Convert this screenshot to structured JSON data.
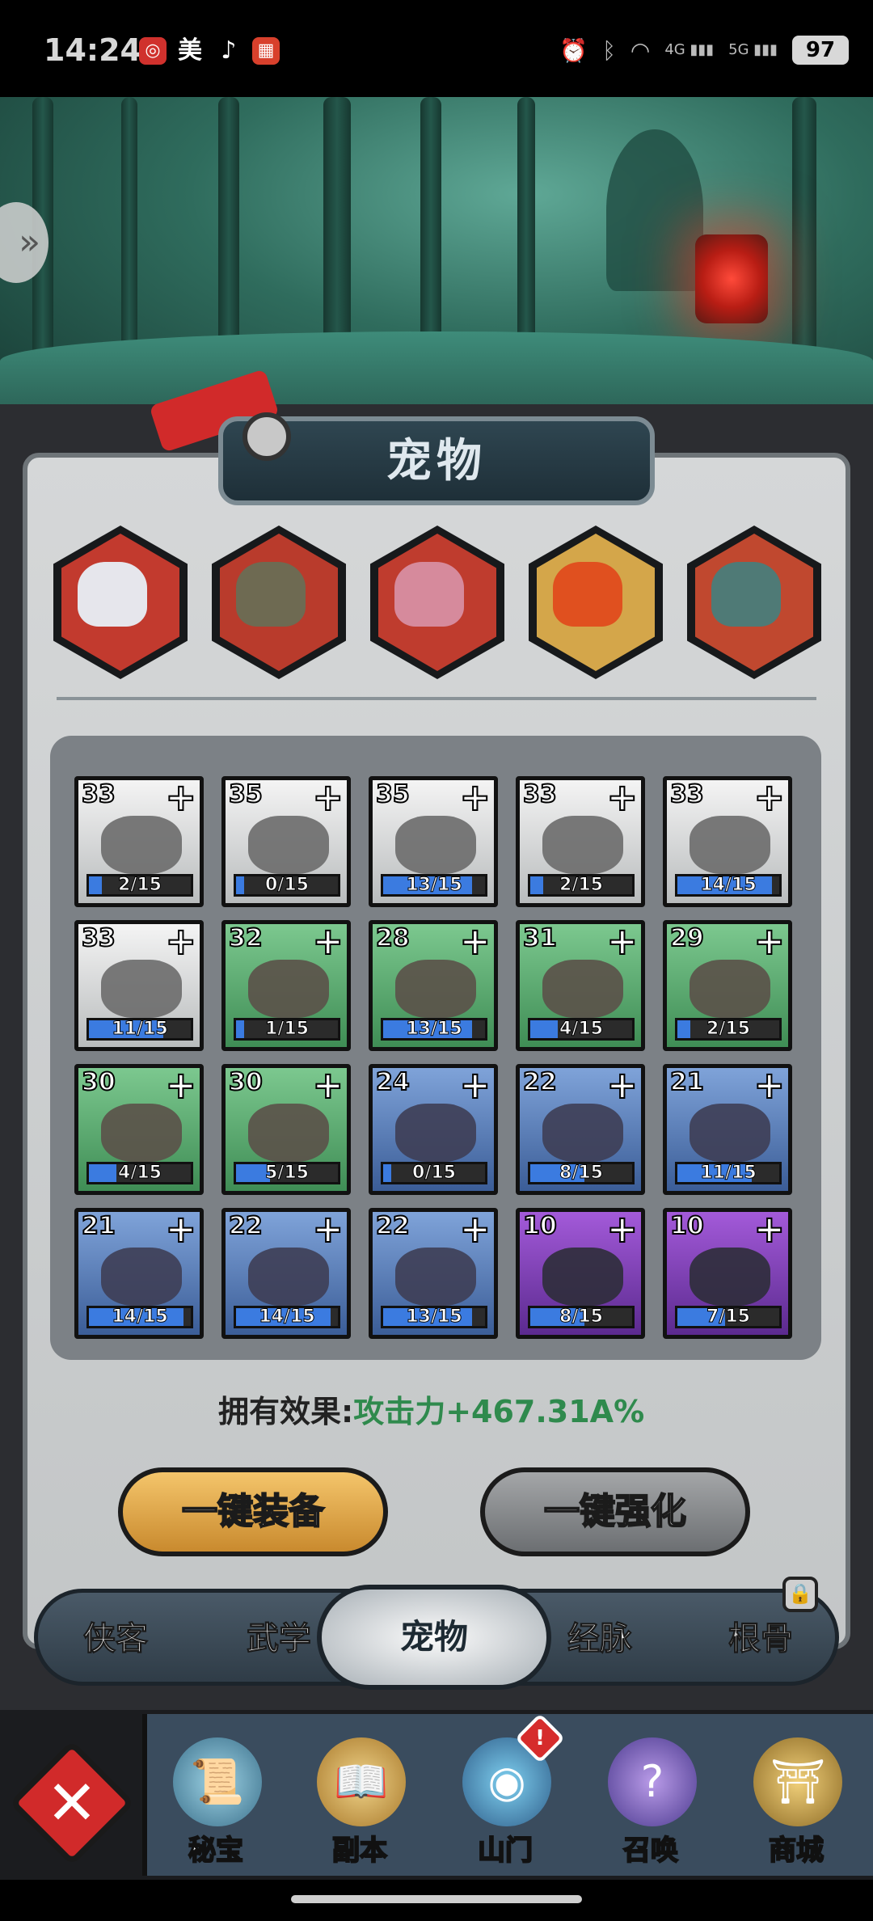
{
  "status_bar": {
    "time": "14:24",
    "battery": "97",
    "network_1": "4G",
    "network_2": "5G",
    "apps": [
      "app-red-icon",
      "美",
      "tiktok-icon",
      "game-icon"
    ]
  },
  "panel": {
    "title": "宠物"
  },
  "equipped_pets": [
    {
      "icon": "yeti-pet-icon",
      "bg": "#c23a2e"
    },
    {
      "icon": "monkey-pet-icon",
      "bg": "#b93b2c"
    },
    {
      "icon": "toad-pet-icon",
      "bg": "#bf3c2e"
    },
    {
      "icon": "fire-spirit-pet-icon",
      "bg": "#d4a64a"
    },
    {
      "icon": "fox-warrior-pet-icon",
      "bg": "#c0482f"
    }
  ],
  "pet_cards": [
    {
      "level": "33",
      "progress": "2/15",
      "fill": 0.13,
      "rarity": "gray",
      "icon": "ballista-pet-icon"
    },
    {
      "level": "35",
      "progress": "0/15",
      "fill": 0.0,
      "rarity": "gray",
      "icon": "boar-pet-icon"
    },
    {
      "level": "35",
      "progress": "13/15",
      "fill": 0.87,
      "rarity": "gray",
      "icon": "bat-pet-icon"
    },
    {
      "level": "33",
      "progress": "2/15",
      "fill": 0.13,
      "rarity": "gray",
      "icon": "fly-pet-icon"
    },
    {
      "level": "33",
      "progress": "14/15",
      "fill": 0.93,
      "rarity": "gray",
      "icon": "spider-pet-icon"
    },
    {
      "level": "33",
      "progress": "11/15",
      "fill": 0.73,
      "rarity": "gray",
      "icon": "fox-pet-icon"
    },
    {
      "level": "32",
      "progress": "1/15",
      "fill": 0.07,
      "rarity": "green",
      "icon": "catapult-pet-icon"
    },
    {
      "level": "28",
      "progress": "13/15",
      "fill": 0.87,
      "rarity": "green",
      "icon": "warthog-pet-icon"
    },
    {
      "level": "31",
      "progress": "4/15",
      "fill": 0.27,
      "rarity": "green",
      "icon": "wolf-pet-icon"
    },
    {
      "level": "29",
      "progress": "2/15",
      "fill": 0.13,
      "rarity": "green",
      "icon": "bee-pet-icon"
    },
    {
      "level": "30",
      "progress": "4/15",
      "fill": 0.27,
      "rarity": "green",
      "icon": "white-wolf-pet-icon"
    },
    {
      "level": "30",
      "progress": "5/15",
      "fill": 0.33,
      "rarity": "green",
      "icon": "swordfish-pet-icon"
    },
    {
      "level": "24",
      "progress": "0/15",
      "fill": 0.0,
      "rarity": "blue",
      "icon": "armored-boar-pet-icon"
    },
    {
      "level": "22",
      "progress": "8/15",
      "fill": 0.53,
      "rarity": "blue",
      "icon": "shark-pet-icon"
    },
    {
      "level": "21",
      "progress": "11/15",
      "fill": 0.73,
      "rarity": "blue",
      "icon": "bird-pet-icon"
    },
    {
      "level": "21",
      "progress": "14/15",
      "fill": 0.93,
      "rarity": "blue",
      "icon": "scorpion-pet-icon"
    },
    {
      "level": "22",
      "progress": "14/15",
      "fill": 0.93,
      "rarity": "blue",
      "icon": "monkey-pet-icon"
    },
    {
      "level": "22",
      "progress": "13/15",
      "fill": 0.87,
      "rarity": "blue",
      "icon": "tiger-pet-icon"
    },
    {
      "level": "10",
      "progress": "8/15",
      "fill": 0.53,
      "rarity": "purple",
      "icon": "cannon-pet-icon"
    },
    {
      "level": "10",
      "progress": "7/15",
      "fill": 0.47,
      "rarity": "purple",
      "icon": "wolf-rider-pet-icon"
    }
  ],
  "effect": {
    "label": "拥有效果:",
    "value": "攻击力+467.31A%"
  },
  "buttons": {
    "equip_all": "一键装备",
    "upgrade_all": "一键强化"
  },
  "tabs": [
    {
      "label": "侠客"
    },
    {
      "label": "武学"
    },
    {
      "label": "宠物",
      "active": true
    },
    {
      "label": "经脉"
    },
    {
      "label": "根骨",
      "locked": true
    }
  ],
  "bottom_nav": [
    {
      "label": "秘宝",
      "icon": "scroll-icon"
    },
    {
      "label": "副本",
      "icon": "dungeon-icon"
    },
    {
      "label": "山门",
      "icon": "gate-icon",
      "alert": "!"
    },
    {
      "label": "召唤",
      "icon": "summon-icon"
    },
    {
      "label": "商城",
      "icon": "shop-icon"
    }
  ],
  "colors": {
    "effect_value": "#2f8a4d",
    "equip_button": "#e0a846",
    "upgrade_button": "#8a8c8e"
  }
}
